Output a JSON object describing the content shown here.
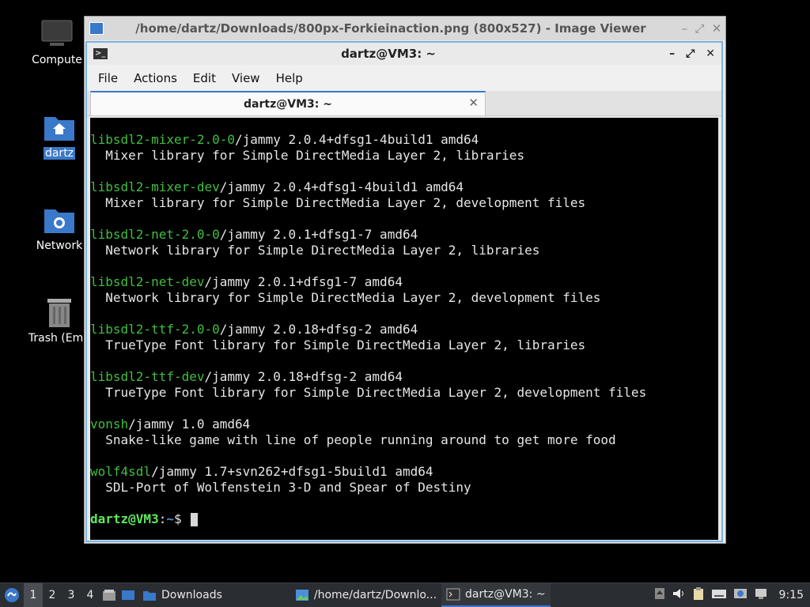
{
  "desktop": {
    "icons": [
      {
        "label": "Compute",
        "icon": "computer-icon"
      },
      {
        "label": "dartz",
        "icon": "home-folder-icon"
      },
      {
        "label": "Network",
        "icon": "network-folder-icon"
      },
      {
        "label": "Trash (Emp",
        "icon": "trash-icon"
      }
    ]
  },
  "viewer": {
    "title": "/home/dartz/Downloads/800px-Forkieinaction.png (800x527) - Image Viewer"
  },
  "terminal": {
    "title": "dartz@VM3: ~",
    "menu": [
      "File",
      "Actions",
      "Edit",
      "View",
      "Help"
    ],
    "tab_label": "dartz@VM3: ~",
    "output": [
      {
        "pkg": "libsdl2-mixer-2.0-0",
        "rest": "/jammy 2.0.4+dfsg1-4build1 amd64",
        "desc": "  Mixer library for Simple DirectMedia Layer 2, libraries"
      },
      {
        "pkg": "libsdl2-mixer-dev",
        "rest": "/jammy 2.0.4+dfsg1-4build1 amd64",
        "desc": "  Mixer library for Simple DirectMedia Layer 2, development files"
      },
      {
        "pkg": "libsdl2-net-2.0-0",
        "rest": "/jammy 2.0.1+dfsg1-7 amd64",
        "desc": "  Network library for Simple DirectMedia Layer 2, libraries"
      },
      {
        "pkg": "libsdl2-net-dev",
        "rest": "/jammy 2.0.1+dfsg1-7 amd64",
        "desc": "  Network library for Simple DirectMedia Layer 2, development files"
      },
      {
        "pkg": "libsdl2-ttf-2.0-0",
        "rest": "/jammy 2.0.18+dfsg-2 amd64",
        "desc": "  TrueType Font library for Simple DirectMedia Layer 2, libraries"
      },
      {
        "pkg": "libsdl2-ttf-dev",
        "rest": "/jammy 2.0.18+dfsg-2 amd64",
        "desc": "  TrueType Font library for Simple DirectMedia Layer 2, development files"
      },
      {
        "pkg": "vonsh",
        "rest": "/jammy 1.0 amd64",
        "desc": "  Snake-like game with line of people running around to get more food"
      },
      {
        "pkg": "wolf4sdl",
        "rest": "/jammy 1.7+svn262+dfsg1-5build1 amd64",
        "desc": "  SDL-Port of Wolfenstein 3-D and Spear of Destiny"
      }
    ],
    "prompt_user": "dartz@VM3",
    "prompt_sep": ":",
    "prompt_path": "~",
    "prompt_symbol": "$"
  },
  "taskbar": {
    "workspaces": [
      "1",
      "2",
      "3",
      "4"
    ],
    "active_workspace": "1",
    "tasks": [
      {
        "label": "Downloads",
        "icon": "folder-icon"
      },
      {
        "label": "/home/dartz/Downlo...",
        "icon": "image-viewer-icon"
      },
      {
        "label": "dartz@VM3: ~",
        "icon": "terminal-icon"
      }
    ],
    "clock": "9:15"
  }
}
